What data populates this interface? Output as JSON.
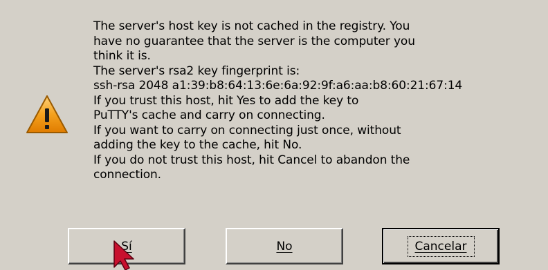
{
  "message": {
    "lines": [
      "The server's host key is not cached in the registry. You",
      "have no guarantee that the server is the computer you",
      "think it is.",
      "The server's rsa2 key fingerprint is:",
      "ssh-rsa 2048 a1:39:b8:64:13:6e:6a:92:9f:a6:aa:b8:60:21:67:14",
      "If you trust this host, hit Yes to add the key to",
      "PuTTY's cache and carry on connecting.",
      "If you want to carry on connecting just once, without",
      "adding the key to the cache, hit No.",
      "If you do not trust this host, hit Cancel to abandon the",
      "connection."
    ]
  },
  "icon": "warning-icon",
  "buttons": {
    "yes": {
      "label": "Sí"
    },
    "no": {
      "label": "No"
    },
    "cancel": {
      "label": "Cancelar"
    }
  },
  "colors": {
    "background": "#d4d0c8",
    "warning": "#f4a11e",
    "cursor": "#c8102e"
  }
}
